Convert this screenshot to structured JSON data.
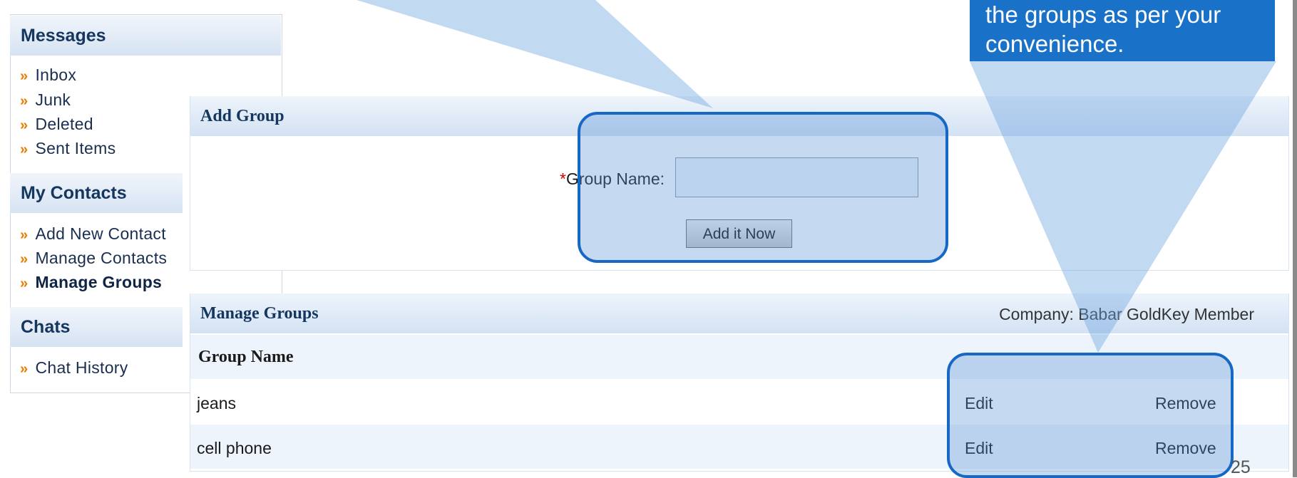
{
  "sidebar": {
    "sections": [
      {
        "title": "Messages",
        "items": [
          "Inbox",
          "Junk",
          "Deleted",
          "Sent Items"
        ]
      },
      {
        "title": "My Contacts",
        "items": [
          "Add New Contact",
          "Manage Contacts",
          "Manage Groups"
        ]
      },
      {
        "title": "Chats",
        "items": [
          "Chat History"
        ]
      }
    ],
    "active_item": "Manage Groups"
  },
  "add_group": {
    "title": "Add Group",
    "required_marker": "*",
    "group_name_label": "Group Name:",
    "group_name_value": "",
    "submit_label": "Add it Now"
  },
  "manage_groups": {
    "title": "Manage Groups",
    "company": "Company: Babar GoldKey Member",
    "column_header": "Group Name",
    "rows": [
      {
        "name": "jeans",
        "edit": "Edit",
        "remove": "Remove"
      },
      {
        "name": "cell phone",
        "edit": "Edit",
        "remove": "Remove"
      }
    ]
  },
  "callout": {
    "lines": [
      "the groups as per your",
      "convenience."
    ]
  },
  "slide_number": "25",
  "colors": {
    "accent": "#1a72c8",
    "header_text": "#15365f",
    "arrow": "#e67e00"
  }
}
